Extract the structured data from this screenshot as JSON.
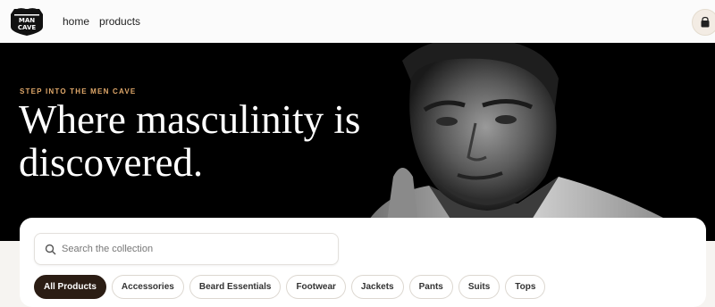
{
  "header": {
    "logo_text_top": "MAN",
    "logo_text_bottom": "CAVE",
    "nav": [
      {
        "label": "home"
      },
      {
        "label": "products"
      }
    ],
    "cart_icon": "shopping-bag-icon"
  },
  "hero": {
    "eyebrow": "STEP INTO THE MEN CAVE",
    "headline": "Where masculinity is discovered."
  },
  "collection": {
    "search_placeholder": "Search the collection",
    "search_icon": "search-icon",
    "categories": [
      {
        "label": "All Products",
        "active": true
      },
      {
        "label": "Accessories"
      },
      {
        "label": "Beard Essentials"
      },
      {
        "label": "Footwear"
      },
      {
        "label": "Jackets"
      },
      {
        "label": "Pants"
      },
      {
        "label": "Suits"
      },
      {
        "label": "Tops"
      }
    ]
  },
  "colors": {
    "accent": "#e0a86a",
    "chip_active_bg": "#2b1d14",
    "hero_bg": "#000000"
  }
}
